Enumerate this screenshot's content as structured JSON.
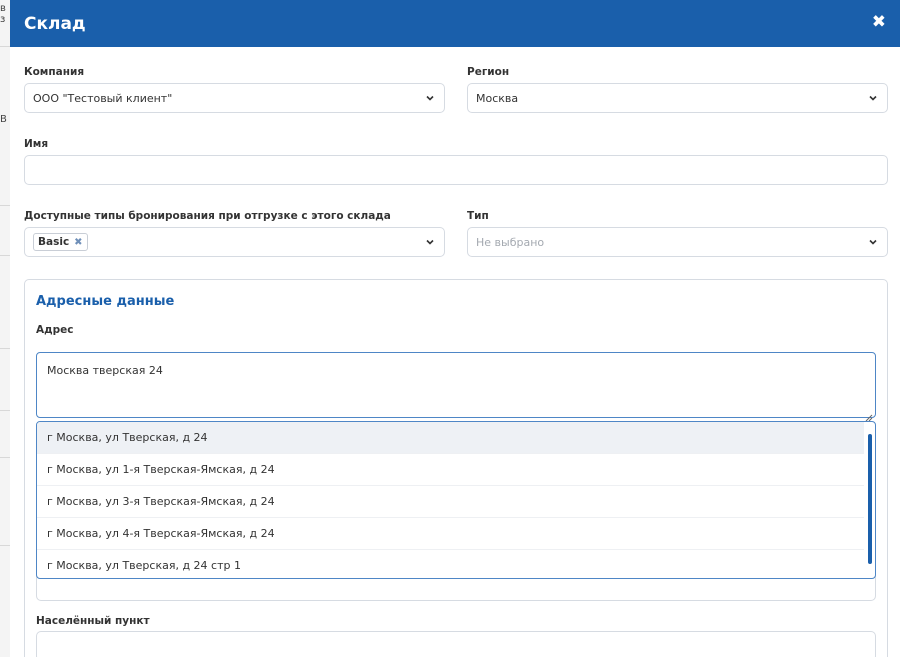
{
  "modal": {
    "title": "Склад",
    "close_icon": "close-icon"
  },
  "background": {
    "chars": [
      "в з",
      "В"
    ]
  },
  "company": {
    "label": "Компания",
    "value": "ООО \"Тестовый клиент\""
  },
  "region": {
    "label": "Регион",
    "value": "Москва"
  },
  "name": {
    "label": "Имя",
    "value": ""
  },
  "booking_types": {
    "label": "Доступные типы бронирования при отгрузке с этого склада",
    "tags": [
      "Basic"
    ]
  },
  "type": {
    "label": "Тип",
    "placeholder": "Не выбрано"
  },
  "address_section": {
    "title": "Адресные данные",
    "address_label": "Адрес",
    "address_value": "Москва тверская 24",
    "suggestions": [
      "г Москва, ул Тверская, д 24",
      "г Москва, ул 1-я Тверская-Ямская, д 24",
      "г Москва, ул 3-я Тверская-Ямская, д 24",
      "г Москва, ул 4-я Тверская-Ямская, д 24",
      "г Москва, ул Тверская, д 24 стр 1"
    ],
    "locality_label": "Населённый пункт"
  },
  "colors": {
    "accent": "#1a5fab",
    "border": "#d6dbe2",
    "focus": "#4e86c6"
  }
}
